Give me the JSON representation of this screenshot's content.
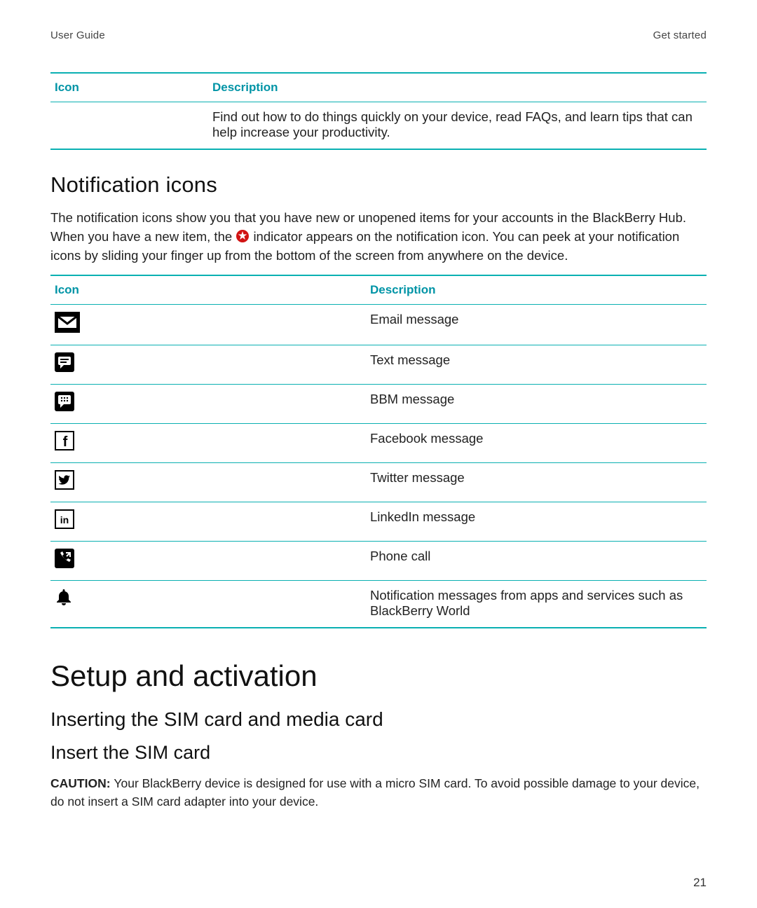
{
  "header": {
    "left": "User Guide",
    "right": "Get started"
  },
  "table1": {
    "headers": [
      "Icon",
      "Description"
    ],
    "row_icon": "",
    "row_desc": "Find out how to do things quickly on your device, read FAQs, and learn tips that can help increase your productivity."
  },
  "notification_section": {
    "heading": "Notification icons",
    "para_before": "The notification icons show you that you have new or unopened items for your accounts in the BlackBerry Hub. When you have a new item, the ",
    "indicator_name": "new-item-indicator",
    "para_after": " indicator appears on the notification icon. You can peek at your notification icons by sliding your finger up from the bottom of the screen from anywhere on the device."
  },
  "table2": {
    "headers": [
      "Icon",
      "Description"
    ],
    "rows": [
      {
        "icon": "email-icon",
        "desc": "Email message"
      },
      {
        "icon": "text-message-icon",
        "desc": "Text message"
      },
      {
        "icon": "bbm-icon",
        "desc": "BBM message"
      },
      {
        "icon": "facebook-icon",
        "desc": "Facebook message"
      },
      {
        "icon": "twitter-icon",
        "desc": "Twitter message"
      },
      {
        "icon": "linkedin-icon",
        "desc": "LinkedIn message"
      },
      {
        "icon": "phone-call-icon",
        "desc": "Phone call"
      },
      {
        "icon": "bell-icon",
        "desc": "Notification messages from apps and services such as BlackBerry World"
      }
    ]
  },
  "setup": {
    "h1": "Setup and activation",
    "h2": "Inserting the SIM card and media card",
    "h3": "Insert the SIM card",
    "caution_label": "CAUTION: ",
    "caution_text": "Your BlackBerry device is designed for use with a micro SIM card. To avoid possible damage to your device, do not insert a SIM card adapter into your device."
  },
  "page_number": "21",
  "colors": {
    "accent": "#0ab0b2",
    "header_text": "#0094a6",
    "indicator_red": "#d11313"
  }
}
